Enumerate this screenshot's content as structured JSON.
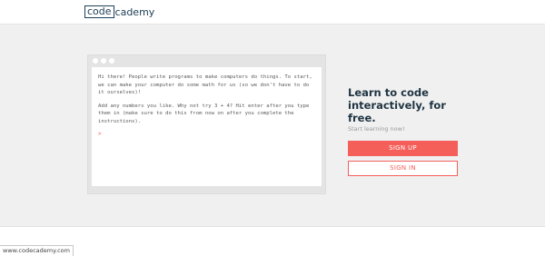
{
  "header": {
    "logo_boxed": "code",
    "logo_rest": "cademy"
  },
  "editor": {
    "paragraph_1": "Hi there! People write programs to make computers do things. To start, we can make your computer do some math for us (so we don't have to do it ourselves)!",
    "paragraph_2": "Add any numbers you like. Why not try 3 + 4? Hit enter after you type them in (make sure to do this from now on after you complete the instructions).",
    "prompt_symbol": ">"
  },
  "signup": {
    "headline": "Learn to code interactively, for free.",
    "subline": "Start learning now!",
    "signup_label": "SIGN UP",
    "signin_label": "SIGN IN"
  },
  "status_bar": {
    "url": "www.codecademy.com"
  },
  "colors": {
    "brand_navy": "#1f4056",
    "accent_red": "#f55f5a",
    "hero_background": "#f0f0f0"
  }
}
